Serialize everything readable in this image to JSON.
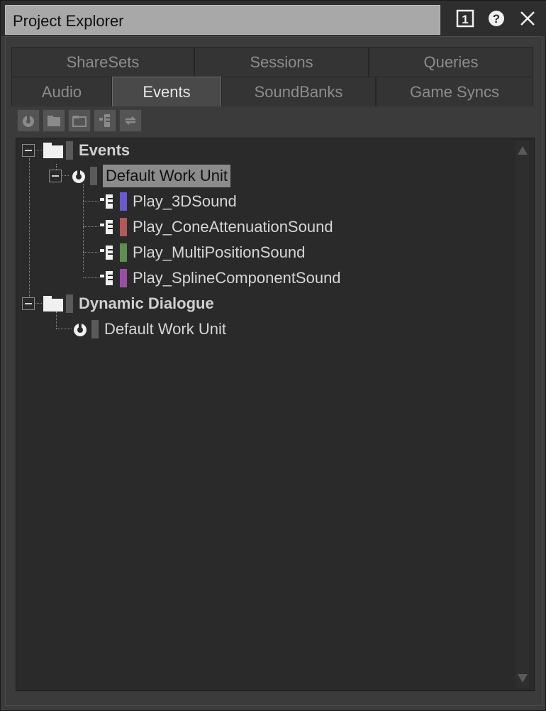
{
  "window": {
    "title": "Project Explorer",
    "icons": [
      "pin-1-icon",
      "help-icon",
      "close-icon"
    ]
  },
  "tabs": {
    "row1": [
      "ShareSets",
      "Sessions",
      "Queries"
    ],
    "row2": [
      "Audio",
      "Events",
      "SoundBanks",
      "Game Syncs"
    ],
    "active": "Events"
  },
  "toolbar": {
    "buttons": [
      "new-work-unit-icon",
      "new-folder-icon",
      "new-virtual-folder-icon",
      "new-event-icon",
      "rename-icon"
    ]
  },
  "tree": {
    "events_root": "Events",
    "events_wu": "Default Work Unit",
    "events": [
      {
        "label": "Play_3DSound",
        "color": "#6a5acd"
      },
      {
        "label": "Play_ConeAttenuationSound",
        "color": "#b4585a"
      },
      {
        "label": "Play_MultiPositionSound",
        "color": "#5b8f4f"
      },
      {
        "label": "Play_SplineComponentSound",
        "color": "#9a4ea3"
      }
    ],
    "dialogue_root": "Dynamic Dialogue",
    "dialogue_wu": "Default Work Unit"
  },
  "colors": {
    "title_bg": "#a8a8a8",
    "panel_bg": "#2a2a2a",
    "selected_bg": "#8c8c8c"
  }
}
